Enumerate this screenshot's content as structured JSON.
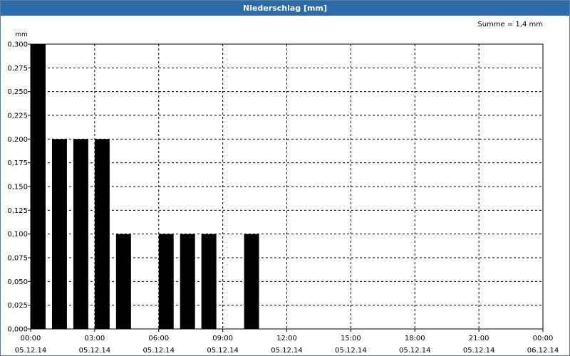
{
  "window": {
    "title": "Niederschlag [mm]"
  },
  "summary": "Summe = 1,4 mm",
  "colors": {
    "titlebar": "#2c6ba6",
    "bar": "#000000",
    "grid": "#000000"
  },
  "chart_data": {
    "type": "bar",
    "title": "Niederschlag [mm]",
    "ylabel": "mm",
    "ylim": [
      0,
      0.3
    ],
    "ytick_step": 0.025,
    "ytick_decimals": 3,
    "decimal_separator": ",",
    "grid": true,
    "x_range": [
      "05.12.14 00:00",
      "06.12.14 00:00"
    ],
    "interval_minutes": 60,
    "x_ticks": [
      {
        "time": "00:00",
        "date": "05.12.14"
      },
      {
        "time": "03:00",
        "date": "05.12.14"
      },
      {
        "time": "06:00",
        "date": "05.12.14"
      },
      {
        "time": "09:00",
        "date": "05.12.14"
      },
      {
        "time": "12:00",
        "date": "05.12.14"
      },
      {
        "time": "15:00",
        "date": "05.12.14"
      },
      {
        "time": "18:00",
        "date": "05.12.14"
      },
      {
        "time": "21:00",
        "date": "05.12.14"
      },
      {
        "time": "00:00",
        "date": "06.12.14"
      }
    ],
    "bars": [
      {
        "time": "05.12.14 00:00",
        "value": 0.3
      },
      {
        "time": "05.12.14 01:00",
        "value": 0.2
      },
      {
        "time": "05.12.14 02:00",
        "value": 0.2
      },
      {
        "time": "05.12.14 03:00",
        "value": 0.2
      },
      {
        "time": "05.12.14 04:00",
        "value": 0.1
      },
      {
        "time": "05.12.14 06:00",
        "value": 0.1
      },
      {
        "time": "05.12.14 07:00",
        "value": 0.1
      },
      {
        "time": "05.12.14 08:00",
        "value": 0.1
      },
      {
        "time": "05.12.14 10:00",
        "value": 0.1
      }
    ]
  }
}
